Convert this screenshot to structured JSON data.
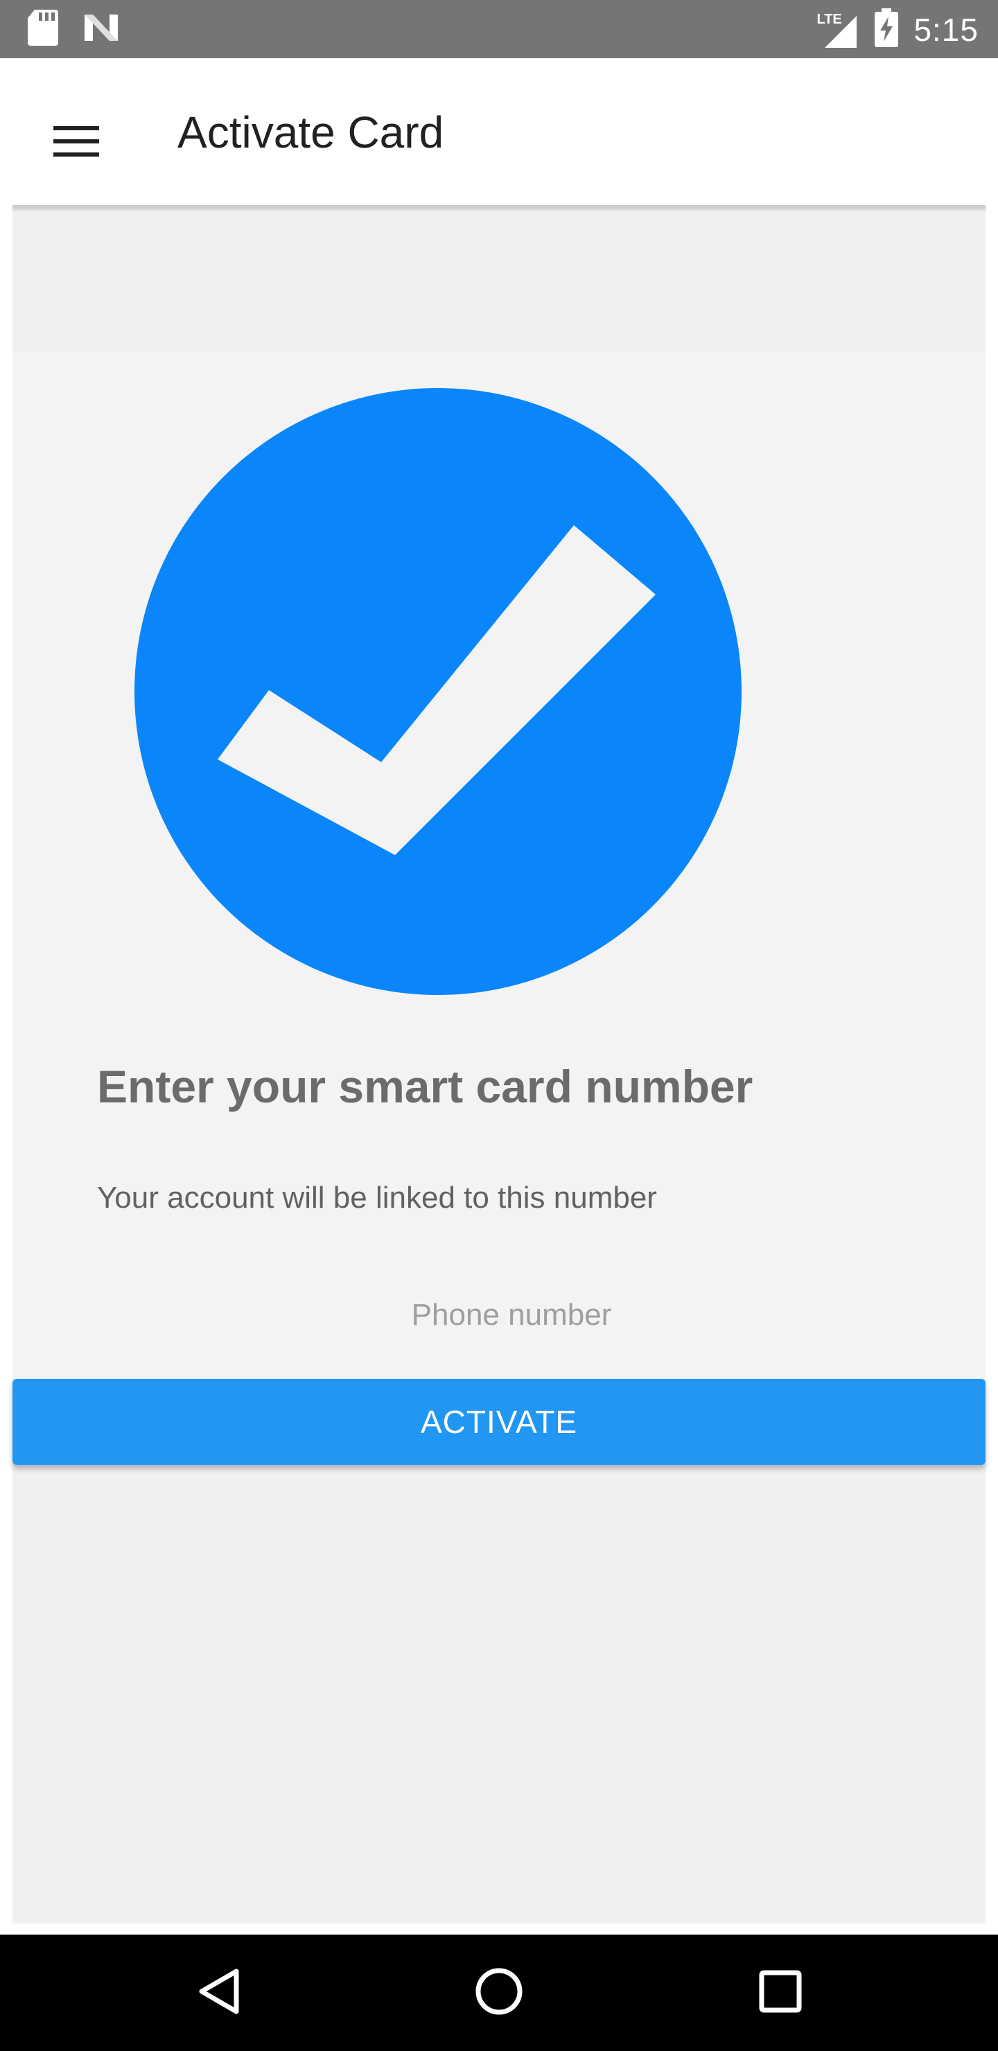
{
  "status_bar": {
    "time": "5:15",
    "network": "LTE",
    "icons": [
      "sd-card-icon",
      "n-logo-icon",
      "lte-signal-icon",
      "battery-charging-icon"
    ]
  },
  "app_bar": {
    "title": "Activate Card",
    "menu_icon": "hamburger-menu-icon"
  },
  "main": {
    "graphic_icon": "checkmark-circle-icon",
    "heading": "Enter your smart card number",
    "subtext": "Your account will be linked to this number",
    "phone_input": {
      "value": "",
      "placeholder": "Phone number"
    },
    "activate_label": "ACTIVATE"
  },
  "nav_bar": {
    "icons": [
      "back-icon",
      "home-icon",
      "recents-icon"
    ]
  },
  "colors": {
    "accent": "#2196f3",
    "check_circle": "#0a86fa",
    "status_bar": "#757575",
    "background": "#f0f0f0"
  }
}
